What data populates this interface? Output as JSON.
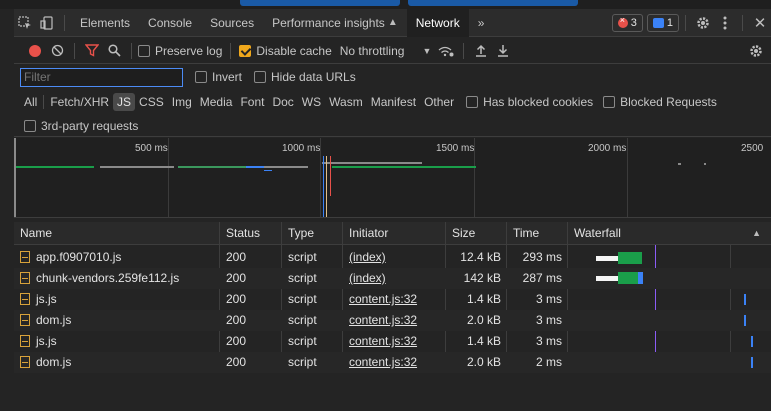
{
  "tabs": {
    "items": [
      "Elements",
      "Console",
      "Sources",
      "Performance insights",
      "Network"
    ],
    "more": "»",
    "errors": "3",
    "messages": "1"
  },
  "toolbar": {
    "preserve_log": "Preserve log",
    "disable_cache": "Disable cache",
    "throttling": "No throttling"
  },
  "filter": {
    "placeholder": "Filter",
    "invert": "Invert",
    "hide_data_urls": "Hide data URLs"
  },
  "types": [
    "All",
    "Fetch/XHR",
    "JS",
    "CSS",
    "Img",
    "Media",
    "Font",
    "Doc",
    "WS",
    "Wasm",
    "Manifest",
    "Other"
  ],
  "type_filters": {
    "blocked_cookies": "Has blocked cookies",
    "blocked_requests": "Blocked Requests",
    "third_party": "3rd-party requests"
  },
  "overview": {
    "ticks": [
      "500 ms",
      "1000 ms",
      "1500 ms",
      "2000 ms",
      "2500"
    ]
  },
  "table": {
    "headers": [
      "Name",
      "Status",
      "Type",
      "Initiator",
      "Size",
      "Time",
      "Waterfall"
    ],
    "rows": [
      {
        "name": "app.f0907010.js",
        "status": "200",
        "type": "script",
        "initiator": "(index)",
        "size": "12.4 kB",
        "time": "293 ms"
      },
      {
        "name": "chunk-vendors.259fe112.js",
        "status": "200",
        "type": "script",
        "initiator": "(index)",
        "size": "142 kB",
        "time": "287 ms"
      },
      {
        "name": "js.js",
        "status": "200",
        "type": "script",
        "initiator": "content.js:32",
        "size": "1.4 kB",
        "time": "3 ms"
      },
      {
        "name": "dom.js",
        "status": "200",
        "type": "script",
        "initiator": "content.js:32",
        "size": "2.0 kB",
        "time": "3 ms"
      },
      {
        "name": "js.js",
        "status": "200",
        "type": "script",
        "initiator": "content.js:32",
        "size": "1.4 kB",
        "time": "3 ms"
      },
      {
        "name": "dom.js",
        "status": "200",
        "type": "script",
        "initiator": "content.js:32",
        "size": "2.0 kB",
        "time": "2 ms"
      }
    ]
  },
  "colors": {
    "accent": "#4c8bf5",
    "record": "#e8514a",
    "checkbox_checked": "#f0a81c",
    "waterfall_download": "#1a9e4a",
    "waterfall_js": "#3b82f6"
  }
}
